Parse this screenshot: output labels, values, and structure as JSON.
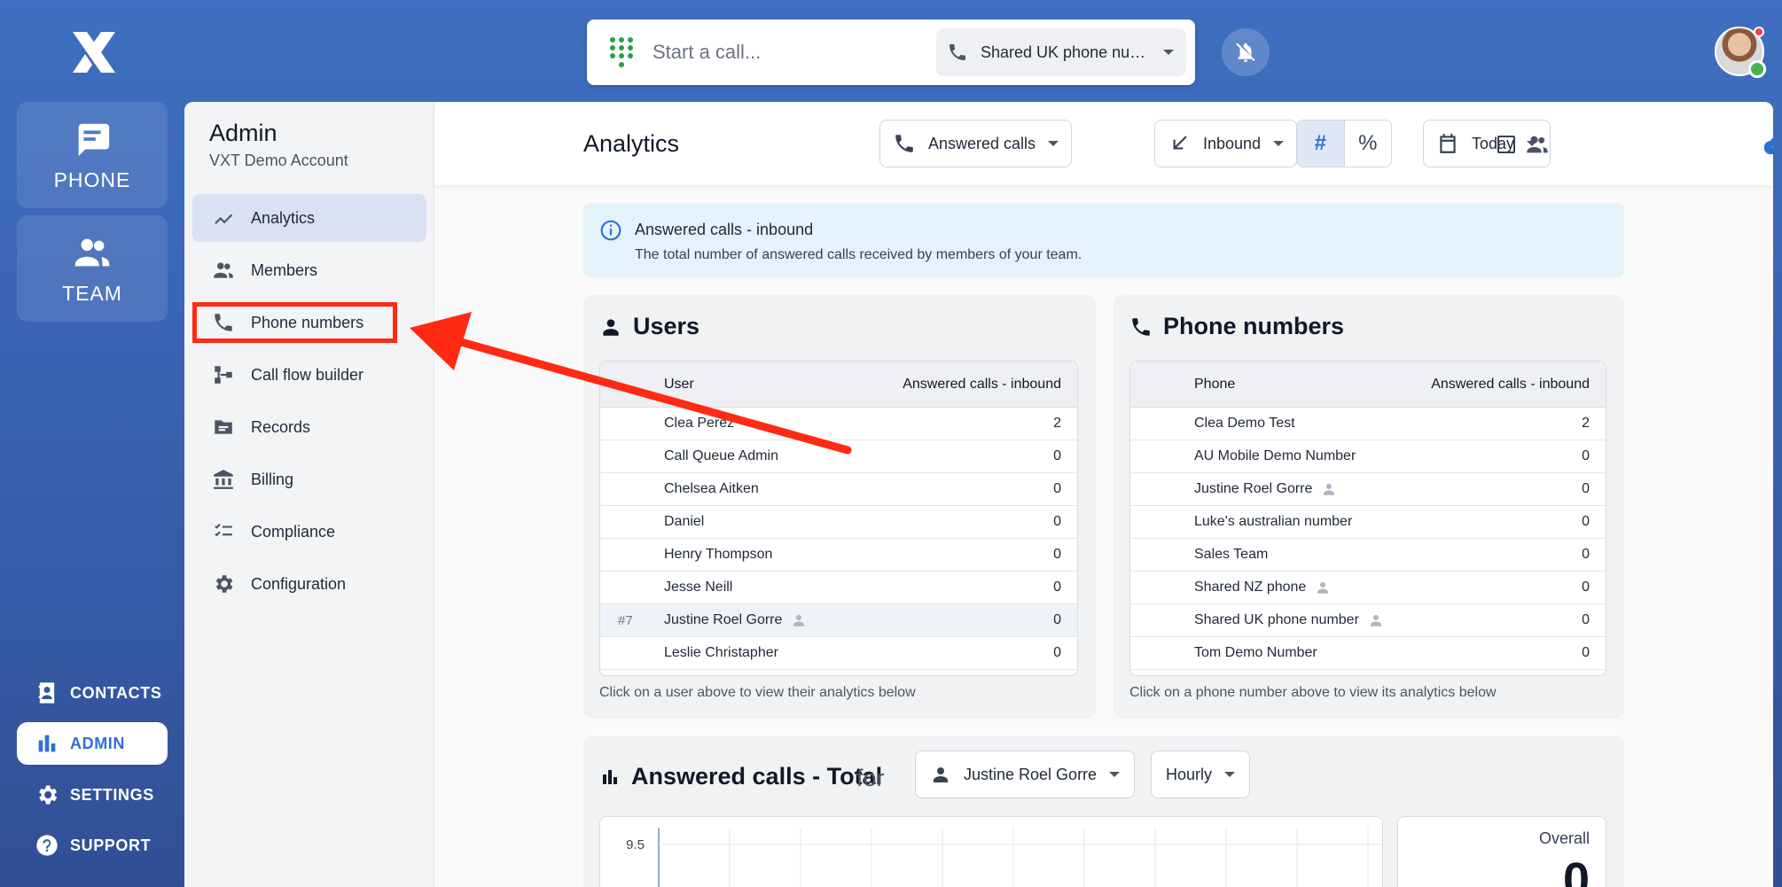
{
  "rail": {
    "phone_label": "PHONE",
    "team_label": "TEAM",
    "contacts_label": "CONTACTS",
    "admin_label": "ADMIN",
    "settings_label": "SETTINGS",
    "support_label": "SUPPORT"
  },
  "topbar": {
    "call_placeholder": "Start a call...",
    "line_selected": "Shared UK phone num...",
    "accent": "#2e6fd1"
  },
  "subnav": {
    "title": "Admin",
    "subtitle": "VXT Demo Account",
    "items": [
      {
        "label": "Analytics",
        "icon": "trend-icon",
        "active": true
      },
      {
        "label": "Members",
        "icon": "people-icon"
      },
      {
        "label": "Phone numbers",
        "icon": "phone-icon"
      },
      {
        "label": "Call flow builder",
        "icon": "flow-icon"
      },
      {
        "label": "Records",
        "icon": "folder-icon"
      },
      {
        "label": "Billing",
        "icon": "bank-icon"
      },
      {
        "label": "Compliance",
        "icon": "checklist-icon"
      },
      {
        "label": "Configuration",
        "icon": "gear-icon"
      }
    ]
  },
  "header": {
    "title": "Analytics",
    "metric_filter": "Answered calls",
    "direction_filter": "Inbound",
    "count_toggle": "#",
    "percent_toggle": "%",
    "date_filter": "Today"
  },
  "banner": {
    "title": "Answered calls - inbound",
    "text": "The total number of answered calls received by members of your team."
  },
  "users_card": {
    "title": "Users",
    "col_name": "User",
    "col_value": "Answered calls - inbound",
    "rows": [
      {
        "rank": "",
        "name": "Clea Perez",
        "value": "2",
        "person": false
      },
      {
        "rank": "",
        "name": "Call Queue Admin",
        "value": "0",
        "person": false
      },
      {
        "rank": "",
        "name": "Chelsea Aitken",
        "value": "0",
        "person": false
      },
      {
        "rank": "",
        "name": "Daniel",
        "value": "0",
        "person": false
      },
      {
        "rank": "",
        "name": "Henry Thompson",
        "value": "0",
        "person": false
      },
      {
        "rank": "",
        "name": "Jesse Neill",
        "value": "0",
        "person": false
      },
      {
        "rank": "#7",
        "name": "Justine Roel Gorre",
        "value": "0",
        "person": true,
        "selected": true
      },
      {
        "rank": "",
        "name": "Leslie Christapher",
        "value": "0",
        "person": false
      }
    ],
    "footer": "Click on a user above to view their analytics below"
  },
  "phones_card": {
    "title": "Phone numbers",
    "col_name": "Phone",
    "col_value": "Answered calls - inbound",
    "rows": [
      {
        "name": "Clea Demo Test",
        "value": "2",
        "person": false
      },
      {
        "name": "AU Mobile Demo Number",
        "value": "0",
        "person": false
      },
      {
        "name": "Justine Roel Gorre",
        "value": "0",
        "person": true
      },
      {
        "name": "Luke's australian number",
        "value": "0",
        "person": false
      },
      {
        "name": "Sales Team",
        "value": "0",
        "person": false
      },
      {
        "name": "Shared NZ phone",
        "value": "0",
        "person": true
      },
      {
        "name": "Shared UK phone number",
        "value": "0",
        "person": true
      },
      {
        "name": "Tom Demo Number",
        "value": "0",
        "person": false
      }
    ],
    "footer": "Click on a phone number above to view its analytics below"
  },
  "chart_card": {
    "title": "Answered calls - Total",
    "for_label": "for",
    "user_select": "Justine Roel Gorre",
    "interval_select": "Hourly",
    "y_tick": "9.5",
    "overall_label": "Overall",
    "overall_value": "0"
  },
  "annotation": {
    "color": "#ff2a14"
  }
}
